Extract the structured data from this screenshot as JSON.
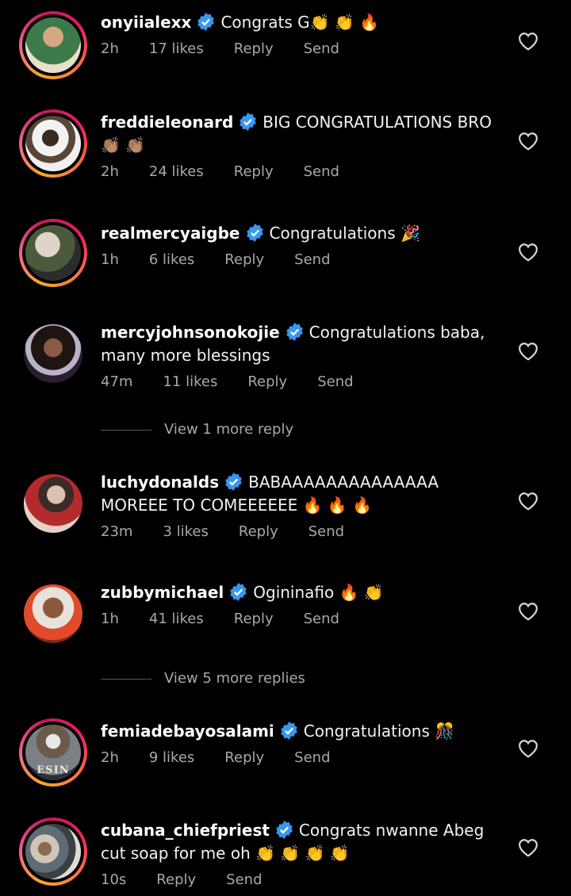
{
  "colors": {
    "background": "#000000",
    "text": "#f2f2f2",
    "muted": "#a8a8a8",
    "verified_blue": "#3897f0"
  },
  "comments": [
    {
      "username": "onyiialexx",
      "text": "Congrats G👏 👏 🔥",
      "time": "2h",
      "likes": "17 likes",
      "reply": "Reply",
      "send": "Send",
      "avatar_colors": [
        "#c7a27b",
        "#2f6b3e"
      ]
    },
    {
      "username": "freddieleonard",
      "text": "BIG CONGRATULATIONS BRO 👏🏽 👏🏽",
      "time": "2h",
      "likes": "24 likes",
      "reply": "Reply",
      "send": "Send",
      "avatar_colors": [
        "#ececec",
        "#3a2a22"
      ]
    },
    {
      "username": "realmercyaigbe",
      "text": "Congratulations 🎉",
      "time": "1h",
      "likes": "6 likes",
      "reply": "Reply",
      "send": "Send",
      "avatar_colors": [
        "#d9cfc4",
        "#4b5a3b"
      ]
    },
    {
      "username": "mercyjohnsonokojie",
      "text": "Congratulations baba, many more blessings",
      "time": "47m",
      "likes": "11 likes",
      "reply": "Reply",
      "send": "Send",
      "avatar_colors": [
        "#6d4534",
        "#1f1412"
      ]
    },
    {
      "username": "luchydonalds",
      "text": "BABAAAAAAAAAAAAAA MOREEE TO COMEEEEEE 🔥 🔥 🔥",
      "time": "23m",
      "likes": "3 likes",
      "reply": "Reply",
      "send": "Send",
      "avatar_colors": [
        "#b32b2b",
        "#e3d2c8"
      ]
    },
    {
      "username": "zubbymichael",
      "text": "Ogininafio 🔥 👏",
      "time": "1h",
      "likes": "41 likes",
      "reply": "Reply",
      "send": "Send",
      "avatar_colors": [
        "#e04b2c",
        "#7a2a1b"
      ]
    },
    {
      "username": "femiadebayosalami",
      "text": "Congratulations 🎊",
      "time": "2h",
      "likes": "9 likes",
      "reply": "Reply",
      "send": "Send",
      "avatar_colors": [
        "#7b7f86",
        "#2d2f36"
      ],
      "avatar_label": "ESIN"
    },
    {
      "username": "cubana_chiefpriest",
      "text": "Congrats nwanne Abeg cut soap for me oh 👏 👏 👏 👏",
      "time": "10s",
      "likes": "",
      "reply": "Reply",
      "send": "Send",
      "avatar_colors": [
        "#cfc6b8",
        "#5c6b74"
      ]
    }
  ],
  "view_more": [
    {
      "label": "View 1 more reply"
    },
    {
      "label": "View 5 more replies"
    }
  ]
}
